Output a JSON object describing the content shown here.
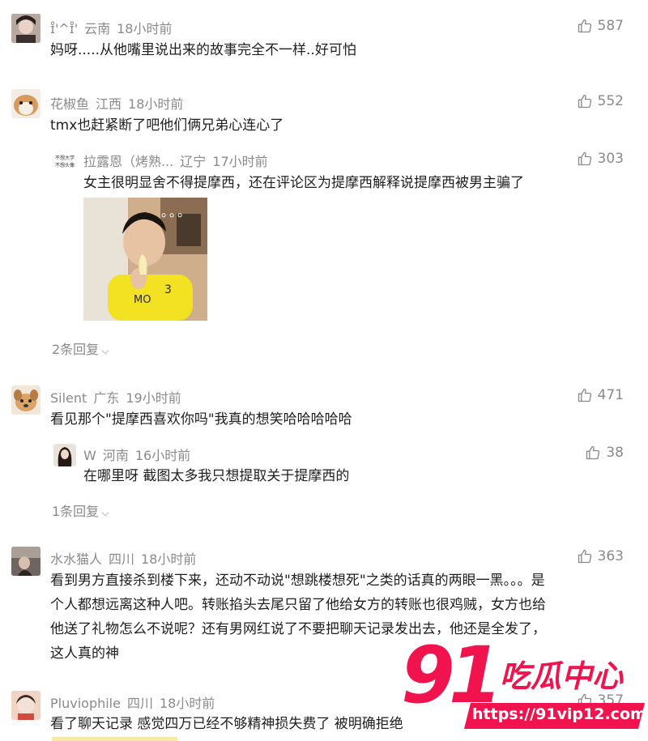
{
  "comments": [
    {
      "user": "ɪ̊'^ɪ̊'",
      "location": "云南",
      "time": "18小时前",
      "text": "妈呀.....从他嘴里说出来的故事完全不一样..好可怕",
      "likes": "587"
    },
    {
      "user": "花椒鱼",
      "location": "江西",
      "time": "18小时前",
      "text": "tmx也赶紧断了吧他们俩兄弟心连心了",
      "likes": "552",
      "reply": {
        "user": "拉露恩（烤熟...",
        "location": "辽宁",
        "time": "17小时前",
        "text": "女主很明显舍不得提摩西，还在评论区为提摩西解释说提摩西被男主骗了",
        "likes": "303",
        "avatar_text": "不想大学 不想头像"
      },
      "more_replies": "2条回复"
    },
    {
      "user": "Silent",
      "location": "广东",
      "time": "19小时前",
      "text": "看见那个\"提摩西喜欢你吗\"我真的想笑哈哈哈哈哈",
      "likes": "471",
      "reply": {
        "user": "W",
        "location": "河南",
        "time": "16小时前",
        "text": "在哪里呀 截图太多我只想提取关于提摩西的",
        "likes": "38"
      },
      "more_replies": "1条回复"
    },
    {
      "user": "水水猫人",
      "location": "四川",
      "time": "18小时前",
      "text_lines": [
        "看到男方直接杀到楼下来，还动不动说\"想跳楼想死\"之类的话真的两眼一黑。。。是",
        "个人都想远离这种人吧。转账掐头去尾只留了他给女方的转账也很鸡贼，女方也给",
        "他送了礼物怎么不说呢？还有男网红说了不要把聊天记录发出去，他还是全发了，",
        "这人真的神"
      ],
      "likes": "363"
    },
    {
      "user": "Pluviophile",
      "location": "四川",
      "time": "18小时前",
      "text": "看了聊天记录 感觉四万已经不够精神损失费了 被明确拒绝",
      "likes": "357"
    }
  ],
  "watermark": {
    "logo_number": "91",
    "logo_text": "吃瓜中心",
    "url": "https://91vip12.com"
  },
  "photo_overlay": "。。。"
}
